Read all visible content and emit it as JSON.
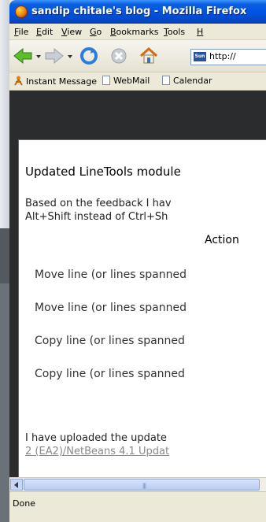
{
  "window": {
    "title": "sandip chitale's blog - Mozilla Firefox"
  },
  "menu": [
    {
      "accel": "F",
      "rest": "ile"
    },
    {
      "accel": "E",
      "rest": "dit"
    },
    {
      "accel": "V",
      "rest": "iew"
    },
    {
      "accel": "G",
      "rest": "o"
    },
    {
      "accel": "B",
      "rest": "ookmarks"
    },
    {
      "accel": "T",
      "rest": "ools"
    },
    {
      "accel": "H",
      "rest": ""
    }
  ],
  "navigation": {
    "url": "http://",
    "url_icon_text": "Sun",
    "icons": [
      "back-icon",
      "forward-icon",
      "reload-icon",
      "stop-icon",
      "home-icon"
    ]
  },
  "bookmarks": [
    {
      "label": "Instant Message",
      "icon": "instant-message-icon"
    },
    {
      "label": "WebMail",
      "icon": "document-icon"
    },
    {
      "label": "Calendar",
      "icon": "document-icon"
    }
  ],
  "post": {
    "title": "Updated LineTools module",
    "para1_line1": "Based on the feedback I hav",
    "para1_line2": "Alt+Shift instead of Ctrl+Sh",
    "table_header": "Action",
    "rows": [
      "Move line (or lines spanned",
      "Move line (or lines spanned",
      "Copy line (or lines spanned",
      "Copy line (or lines spanned"
    ],
    "para2_line1": "I have uploaded the update",
    "para2_link": "2 (EA2)/NetBeans 4.1 Updat"
  },
  "status": {
    "text": "Done"
  },
  "colors": {
    "titlebar": "#0054e3",
    "panel_border": "#b24848",
    "page_background": "#2a2c2e"
  }
}
